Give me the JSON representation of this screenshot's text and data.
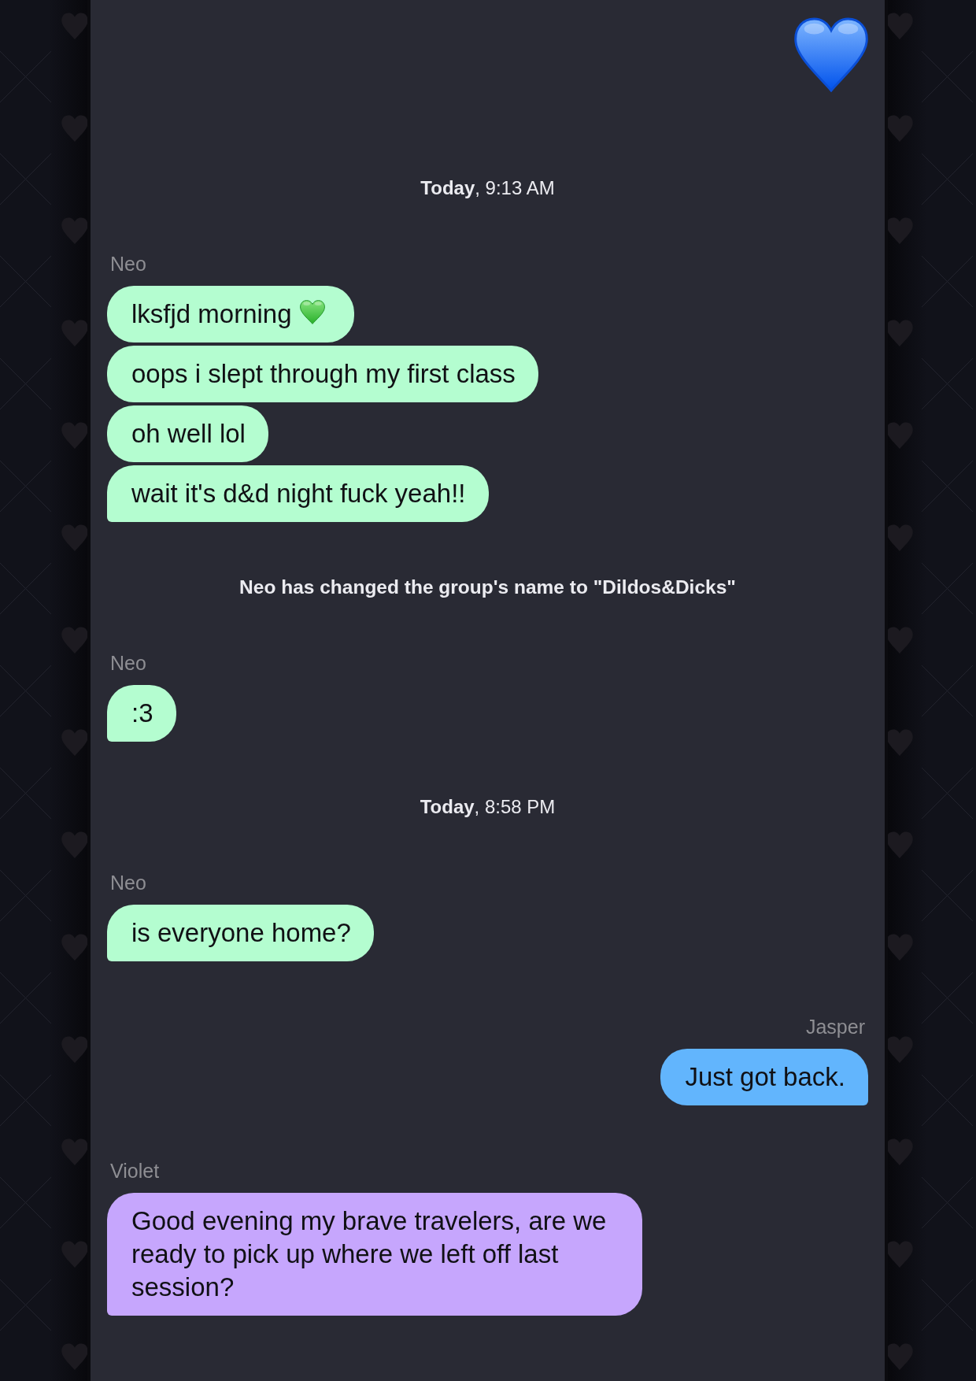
{
  "items": [
    {
      "kind": "emoji",
      "outgoing": true
    },
    {
      "kind": "timestamp",
      "text": "**Today**, 9:13 AM"
    },
    {
      "kind": "group",
      "sender": "Neo",
      "outgoing": false,
      "color": "#b4fdd0",
      "messages": [
        {
          "text": "lksfjd morning",
          "emoji": true,
          "tail": false
        },
        {
          "text": "oops i slept through my first class",
          "emoji": false,
          "tail": false
        },
        {
          "text": "oh well lol",
          "emoji": false,
          "tail": false
        },
        {
          "text": "wait it's d&d night fuck yeah!!",
          "emoji": false,
          "tail": true
        }
      ]
    },
    {
      "kind": "notice",
      "text": "**Neo has changed the group's name to \"Dildos&Dicks\"**"
    },
    {
      "kind": "group",
      "sender": "Neo",
      "outgoing": false,
      "color": "#b4fdd0",
      "messages": [
        {
          "text": ":3",
          "emoji": false,
          "tail": true
        }
      ]
    },
    {
      "kind": "timestamp",
      "text": "**Today**, 8:58 PM"
    },
    {
      "kind": "group",
      "sender": "Neo",
      "outgoing": false,
      "color": "#b4fdd0",
      "messages": [
        {
          "text": "is everyone home?",
          "emoji": false,
          "tail": true
        }
      ]
    },
    {
      "kind": "group",
      "sender": "Jasper",
      "outgoing": true,
      "color": "#62b5fd",
      "messages": [
        {
          "text": "Just got back.",
          "emoji": false,
          "tail": true
        }
      ]
    },
    {
      "kind": "group",
      "sender": "Violet",
      "outgoing": false,
      "color": "#c6a6fd",
      "messages": [
        {
          "text": "Good evening my brave travelers, are we ready to pick up where we left off last session?",
          "emoji": false,
          "tail": true
        }
      ]
    }
  ]
}
